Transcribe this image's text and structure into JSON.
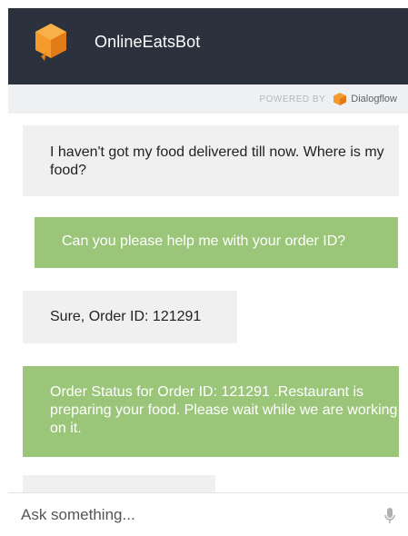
{
  "header": {
    "title": "OnlineEatsBot"
  },
  "powered": {
    "prefix": "POWERED BY",
    "brand": "Dialogflow"
  },
  "messages": [
    {
      "sender": "user",
      "text": "I haven't got my food delivered till now. Where is my food?"
    },
    {
      "sender": "bot",
      "text": "Can you please help me with your order ID?"
    },
    {
      "sender": "user",
      "text": "Sure, Order ID: 121291"
    },
    {
      "sender": "bot",
      "text": "Order Status for Order ID: 121291 .Restaurant is preparing your food. Please wait while we are working on it."
    },
    {
      "sender": "user",
      "text": ""
    }
  ],
  "input": {
    "placeholder": "Ask something...",
    "value": ""
  },
  "icons": {
    "logo": "dialogflow-cube-icon",
    "mic": "microphone-icon"
  },
  "colors": {
    "header": "#2b323d",
    "bot_bubble": "#9bc67a",
    "user_bubble": "#f0f0f0",
    "accent": "#f4922c"
  }
}
